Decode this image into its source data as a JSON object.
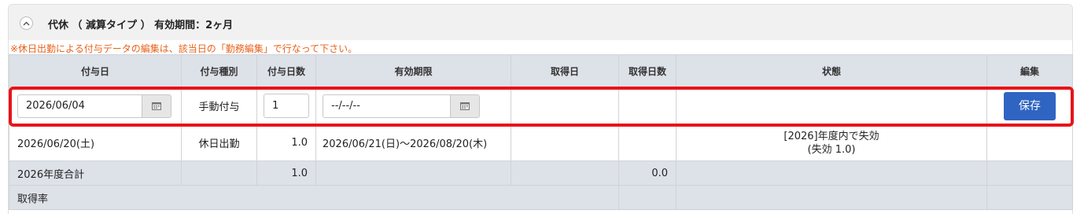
{
  "panel": {
    "title": "代休 （ 減算タイプ ） 有効期間：2ヶ月",
    "notice": "※休日出勤による付与データの編集は、該当日の「勤務編集」で行なって下さい。"
  },
  "table": {
    "headers": [
      "付与日",
      "付与種別",
      "付与日数",
      "有効期限",
      "取得日",
      "取得日数",
      "状態",
      "編集"
    ],
    "edit_row": {
      "grant_date": "2026/06/04",
      "grant_type": "手動付与",
      "grant_days": "1",
      "expiry": "--/--/--",
      "save_label": "保存"
    },
    "data_row": {
      "grant_date": "2026/06/20(土)",
      "grant_type": "休日出勤",
      "grant_days": "1.0",
      "expiry": "2026/06/21(日)～2026/08/20(木)",
      "acquired_date": "",
      "acquired_days": "",
      "status_line1": "[2026]年度内で失効",
      "status_line2": "(失効 1.0)"
    },
    "total_row": {
      "label": "2026年度合計",
      "grant_days": "1.0",
      "acquired_days": "0.0"
    },
    "rate_row": {
      "label": "取得率"
    }
  },
  "colors": {
    "highlight": "#e8141a",
    "save_button": "#2f64c2",
    "notice_text": "#e8611a",
    "header_bg": "#dde1e8"
  }
}
